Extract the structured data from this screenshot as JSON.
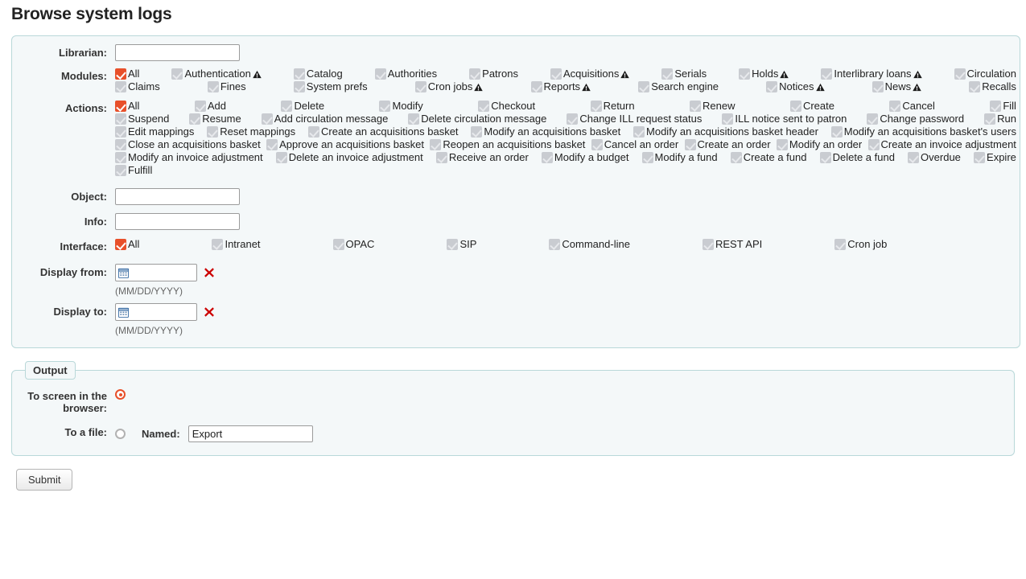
{
  "page": {
    "title": "Browse system logs"
  },
  "form": {
    "librarian": {
      "label": "Librarian:",
      "value": "",
      "placeholder": ""
    },
    "modules": {
      "label": "Modules:",
      "rows": [
        [
          {
            "label": "All",
            "checked": true,
            "warn": false
          },
          {
            "label": "Authentication",
            "checked": false,
            "warn": true
          },
          {
            "label": "Catalog",
            "checked": false,
            "warn": false
          },
          {
            "label": "Authorities",
            "checked": false,
            "warn": false
          },
          {
            "label": "Patrons",
            "checked": false,
            "warn": false
          },
          {
            "label": "Acquisitions",
            "checked": false,
            "warn": true
          },
          {
            "label": "Serials",
            "checked": false,
            "warn": false
          },
          {
            "label": "Holds",
            "checked": false,
            "warn": true
          },
          {
            "label": "Interlibrary loans",
            "checked": false,
            "warn": true
          },
          {
            "label": "Circulation",
            "checked": false,
            "warn": false
          }
        ],
        [
          {
            "label": "Claims",
            "checked": false,
            "warn": false
          },
          {
            "label": "Fines",
            "checked": false,
            "warn": false
          },
          {
            "label": "System prefs",
            "checked": false,
            "warn": false
          },
          {
            "label": "Cron jobs",
            "checked": false,
            "warn": true
          },
          {
            "label": "Reports",
            "checked": false,
            "warn": true
          },
          {
            "label": "Search engine",
            "checked": false,
            "warn": false
          },
          {
            "label": "Notices",
            "checked": false,
            "warn": true
          },
          {
            "label": "News",
            "checked": false,
            "warn": true
          },
          {
            "label": "Recalls",
            "checked": false,
            "warn": false
          }
        ]
      ]
    },
    "actions": {
      "label": "Actions:",
      "rows": [
        [
          {
            "label": "All",
            "checked": true
          },
          {
            "label": "Add",
            "checked": false
          },
          {
            "label": "Delete",
            "checked": false
          },
          {
            "label": "Modify",
            "checked": false
          },
          {
            "label": "Checkout",
            "checked": false
          },
          {
            "label": "Return",
            "checked": false
          },
          {
            "label": "Renew",
            "checked": false
          },
          {
            "label": "Create",
            "checked": false
          },
          {
            "label": "Cancel",
            "checked": false
          },
          {
            "label": "Fill",
            "checked": false
          }
        ],
        [
          {
            "label": "Suspend",
            "checked": false
          },
          {
            "label": "Resume",
            "checked": false
          },
          {
            "label": "Add circulation message",
            "checked": false
          },
          {
            "label": "Delete circulation message",
            "checked": false
          },
          {
            "label": "Change ILL request status",
            "checked": false
          },
          {
            "label": "ILL notice sent to patron",
            "checked": false
          },
          {
            "label": "Change password",
            "checked": false
          },
          {
            "label": "Run",
            "checked": false
          }
        ],
        [
          {
            "label": "Edit mappings",
            "checked": false
          },
          {
            "label": "Reset mappings",
            "checked": false
          },
          {
            "label": "Create an acquisitions basket",
            "checked": false
          },
          {
            "label": "Modify an acquisitions basket",
            "checked": false
          },
          {
            "label": "Modify an acquisitions basket header",
            "checked": false
          },
          {
            "label": "Modify an acquisitions basket's users",
            "checked": false
          }
        ],
        [
          {
            "label": "Close an acquisitions basket",
            "checked": false
          },
          {
            "label": "Approve an acquisitions basket",
            "checked": false
          },
          {
            "label": "Reopen an acquisitions basket",
            "checked": false
          },
          {
            "label": "Cancel an order",
            "checked": false
          },
          {
            "label": "Create an order",
            "checked": false
          },
          {
            "label": "Modify an order",
            "checked": false
          },
          {
            "label": "Create an invoice adjustment",
            "checked": false
          }
        ],
        [
          {
            "label": "Modify an invoice adjustment",
            "checked": false
          },
          {
            "label": "Delete an invoice adjustment",
            "checked": false
          },
          {
            "label": "Receive an order",
            "checked": false
          },
          {
            "label": "Modify a budget",
            "checked": false
          },
          {
            "label": "Modify a fund",
            "checked": false
          },
          {
            "label": "Create a fund",
            "checked": false
          },
          {
            "label": "Delete a fund",
            "checked": false
          },
          {
            "label": "Overdue",
            "checked": false
          },
          {
            "label": "Expire",
            "checked": false
          }
        ],
        [
          {
            "label": "Fulfill",
            "checked": false
          }
        ]
      ]
    },
    "object": {
      "label": "Object:",
      "value": ""
    },
    "info": {
      "label": "Info:",
      "value": ""
    },
    "interface": {
      "label": "Interface:",
      "items": [
        {
          "label": "All",
          "checked": true
        },
        {
          "label": "Intranet",
          "checked": false
        },
        {
          "label": "OPAC",
          "checked": false
        },
        {
          "label": "SIP",
          "checked": false
        },
        {
          "label": "Command-line",
          "checked": false
        },
        {
          "label": "REST API",
          "checked": false
        },
        {
          "label": "Cron job",
          "checked": false
        }
      ]
    },
    "display_from": {
      "label": "Display from:",
      "value": "",
      "hint": "(MM/DD/YYYY)"
    },
    "display_to": {
      "label": "Display to:",
      "value": "",
      "hint": "(MM/DD/YYYY)"
    }
  },
  "output": {
    "legend": "Output",
    "to_screen": {
      "label": "To screen in the browser:",
      "selected": true
    },
    "to_file": {
      "label": "To a file:",
      "selected": false
    },
    "named": {
      "label": "Named:",
      "value": "Export"
    }
  },
  "submit": {
    "label": "Submit"
  },
  "colors": {
    "accent": "#e8502a",
    "fieldset_border": "#b9d8d9",
    "fieldset_bg": "#f4f8f9",
    "clear_red": "#cc0000",
    "checkbox_disabled": "#c9ccd1"
  }
}
